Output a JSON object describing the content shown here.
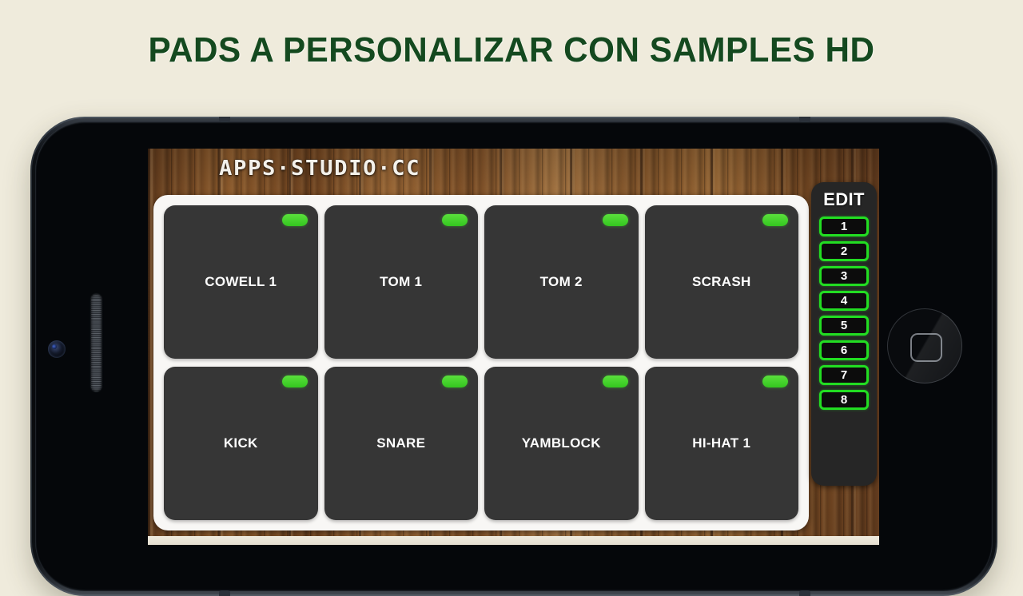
{
  "page": {
    "background_color": "#efebdc",
    "headline": "PADS A PERSONALIZAR CON SAMPLES HD",
    "headline_color": "#14491f"
  },
  "device": {
    "type": "smartphone-landscape",
    "body_color": "#0a0d12",
    "camera": "camera-lens",
    "earpiece": "speaker-grille",
    "home_button": "home-button"
  },
  "app": {
    "logo": "APPS·STUDIO·CC",
    "background": "wood-texture",
    "accent_green": "#22dd22",
    "led_green": "#45d12e",
    "pad_color": "#363636",
    "panel_color": "#f8f7f5",
    "pads": [
      {
        "label": "COWELL 1",
        "led": "on"
      },
      {
        "label": "TOM 1",
        "led": "on"
      },
      {
        "label": "TOM 2",
        "led": "on"
      },
      {
        "label": "SCRASH",
        "led": "on"
      },
      {
        "label": "KICK",
        "led": "on"
      },
      {
        "label": "SNARE",
        "led": "on"
      },
      {
        "label": "YAMBLOCK",
        "led": "on"
      },
      {
        "label": "HI-HAT 1",
        "led": "on"
      }
    ],
    "edit_panel": {
      "title": "EDIT",
      "buttons": [
        {
          "label": "1"
        },
        {
          "label": "2"
        },
        {
          "label": "3"
        },
        {
          "label": "4"
        },
        {
          "label": "5"
        },
        {
          "label": "6"
        },
        {
          "label": "7"
        },
        {
          "label": "8"
        }
      ]
    }
  }
}
